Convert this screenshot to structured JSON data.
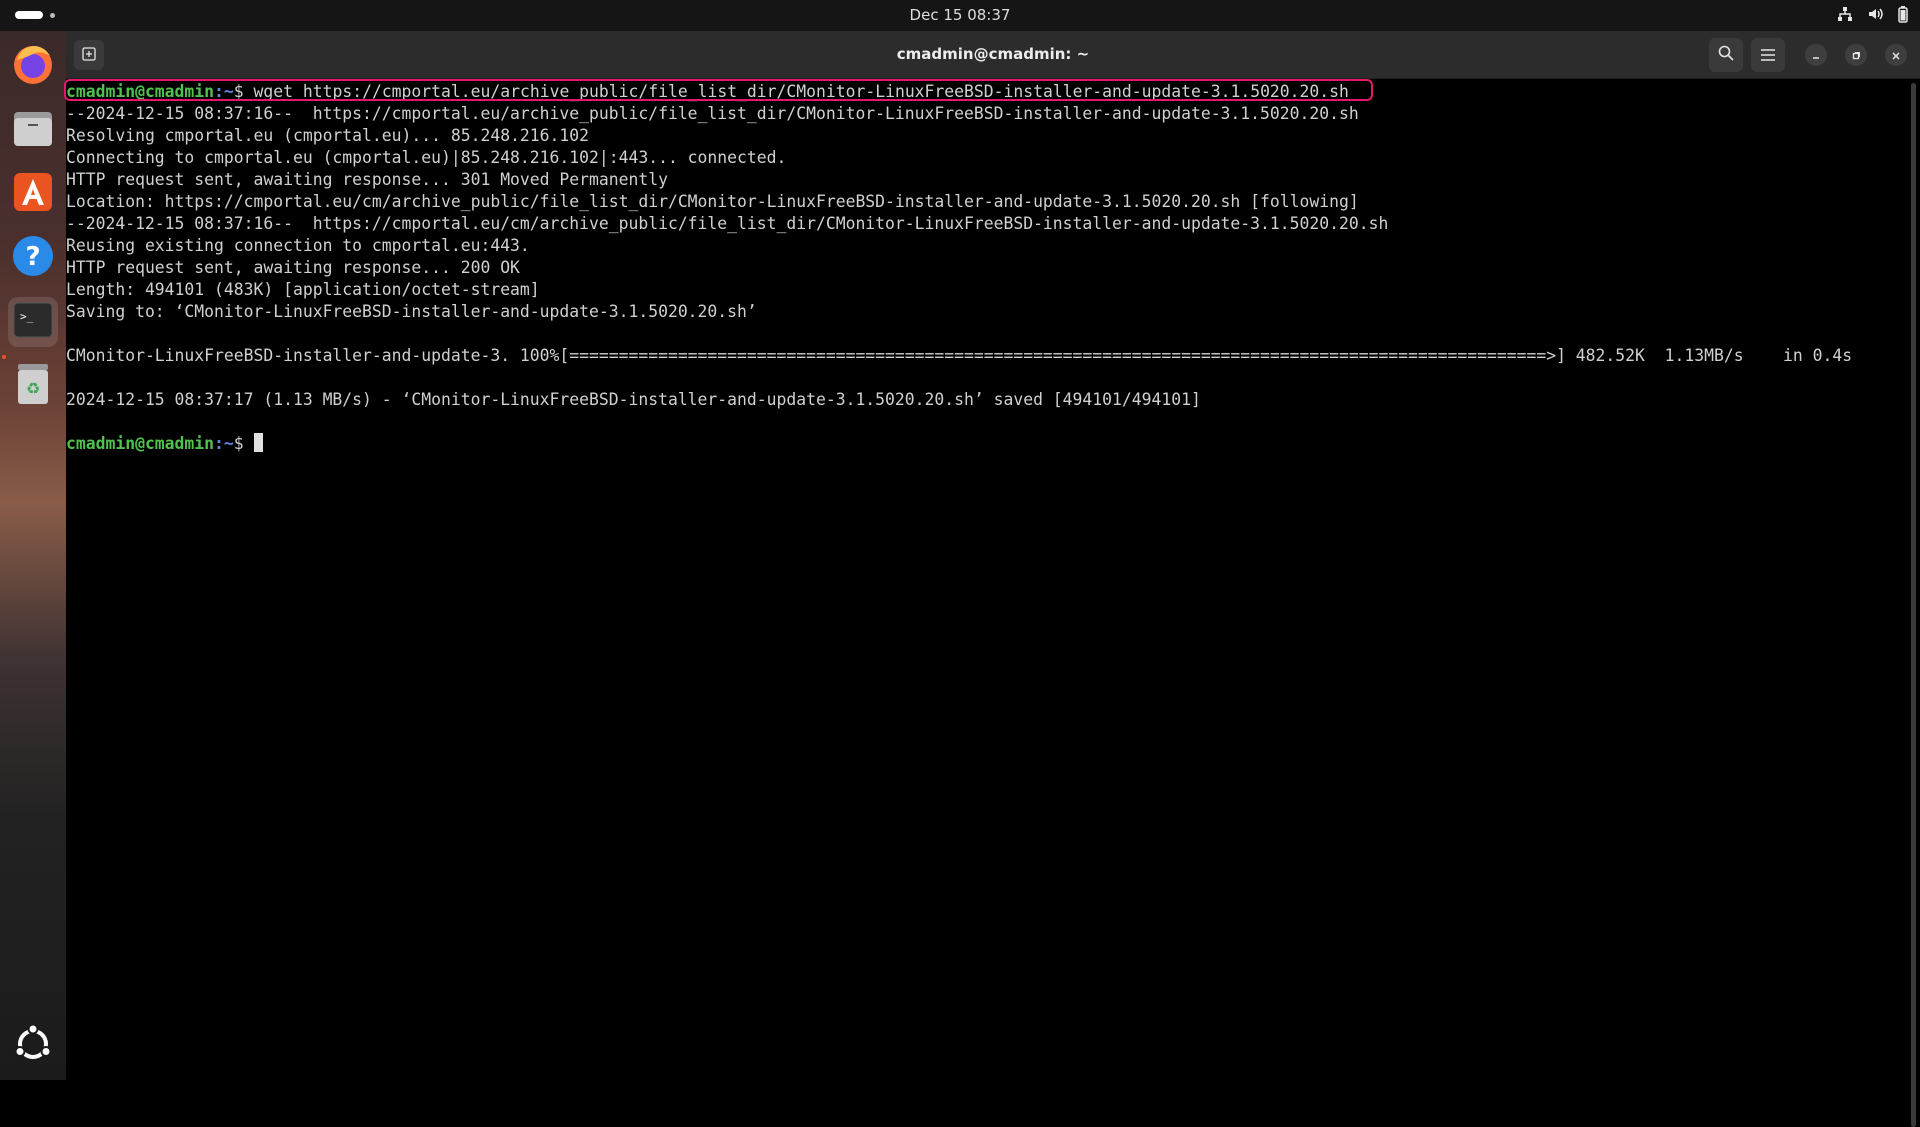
{
  "topbar": {
    "clock": "Dec 15  08:37",
    "tray_icons": [
      "network-icon",
      "volume-icon",
      "battery-icon"
    ]
  },
  "dock": {
    "apps": [
      {
        "name": "Firefox",
        "icon": "firefox-icon"
      },
      {
        "name": "Files",
        "icon": "files-icon"
      },
      {
        "name": "App Center",
        "icon": "app-center-icon"
      },
      {
        "name": "Help",
        "icon": "help-icon"
      },
      {
        "name": "Terminal",
        "icon": "terminal-icon"
      },
      {
        "name": "Trash",
        "icon": "trash-icon"
      }
    ],
    "show_apps_icon": "ubuntu-logo-icon"
  },
  "window": {
    "title": "cmadmin@cmadmin: ~"
  },
  "terminal": {
    "prompt_user": "cmadmin@cmadmin",
    "prompt_path": ":~",
    "prompt_symbol": "$ ",
    "command": "wget https://cmportal.eu/archive_public/file_list_dir/CMonitor-LinuxFreeBSD-installer-and-update-3.1.5020.20.sh",
    "output": [
      "--2024-12-15 08:37:16--  https://cmportal.eu/archive_public/file_list_dir/CMonitor-LinuxFreeBSD-installer-and-update-3.1.5020.20.sh",
      "Resolving cmportal.eu (cmportal.eu)... 85.248.216.102",
      "Connecting to cmportal.eu (cmportal.eu)|85.248.216.102|:443... connected.",
      "HTTP request sent, awaiting response... 301 Moved Permanently",
      "Location: https://cmportal.eu/cm/archive_public/file_list_dir/CMonitor-LinuxFreeBSD-installer-and-update-3.1.5020.20.sh [following]",
      "--2024-12-15 08:37:16--  https://cmportal.eu/cm/archive_public/file_list_dir/CMonitor-LinuxFreeBSD-installer-and-update-3.1.5020.20.sh",
      "Reusing existing connection to cmportal.eu:443.",
      "HTTP request sent, awaiting response... 200 OK",
      "Length: 494101 (483K) [application/octet-stream]",
      "Saving to: ‘CMonitor-LinuxFreeBSD-installer-and-update-3.1.5020.20.sh’",
      "",
      "CMonitor-LinuxFreeBSD-installer-and-update-3. 100%[===================================================================================================>] 482.52K  1.13MB/s    in 0.4s",
      "",
      "2024-12-15 08:37:17 (1.13 MB/s) - ‘CMonitor-LinuxFreeBSD-installer-and-update-3.1.5020.20.sh’ saved [494101/494101]",
      ""
    ],
    "accent_highlight": "#e6176b",
    "prompt_color": "#4fc24f"
  }
}
